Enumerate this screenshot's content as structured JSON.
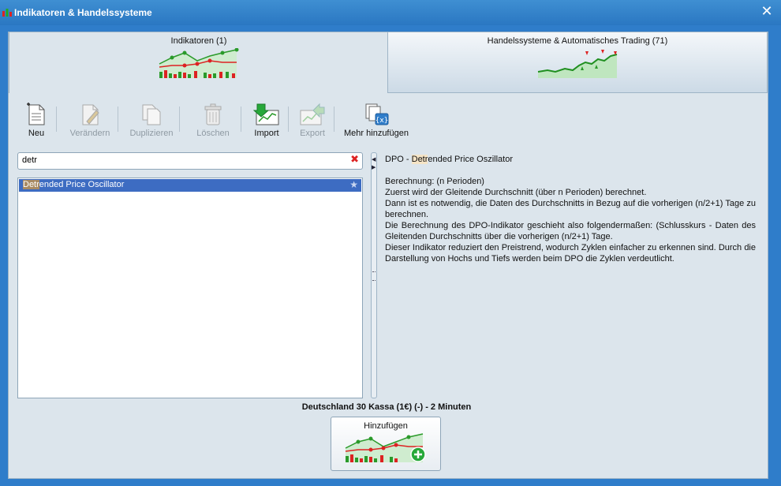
{
  "window": {
    "title": "Indikatoren & Handelssysteme",
    "close": "✕"
  },
  "tabs": [
    {
      "label": "Indikatoren (1)",
      "active": true
    },
    {
      "label": "Handelssysteme & Automatisches Trading (71)",
      "active": false
    }
  ],
  "toolbar": {
    "new": "Neu",
    "edit": "Verändern",
    "duplicate": "Duplizieren",
    "delete": "Löschen",
    "import": "Import",
    "export": "Export",
    "add_more": "Mehr hinzufügen"
  },
  "search": {
    "value": "detr",
    "clear": "✖"
  },
  "list": {
    "items": [
      {
        "match": "Detr",
        "rest": "ended Price Oscillator",
        "star": "★",
        "selected": true
      }
    ]
  },
  "description": {
    "title_pre": "DPO - ",
    "title_match": "Detr",
    "title_post": "ended Price Oszillator",
    "lines": [
      "Berechnung: (n Perioden)",
      "Zuerst wird der Gleitende Durchschnitt (über n Perioden) berechnet.",
      "Dann ist es notwendig, die Daten des Durchschnitts in Bezug auf die vorherigen (n/2+1) Tage zu berechnen.",
      "Die Berechnung des DPO-Indikator geschieht also folgendermaßen: (Schlusskurs - Daten des Gleitenden Durchschnitts über die vorherigen (n/2+1) Tage.",
      "Dieser Indikator reduziert den Preistrend, wodurch Zyklen einfacher zu erkennen sind. Durch die Darstellung von Hochs und Tiefs werden beim DPO die Zyklen verdeutlicht."
    ]
  },
  "market": "Deutschland 30 Kassa (1€) (-) - 2 Minuten",
  "add_button": "Hinzufügen",
  "colors": {
    "titlebar": "#2a77c2",
    "selection": "#3d6cc2",
    "highlight": "#f5e4c6"
  }
}
